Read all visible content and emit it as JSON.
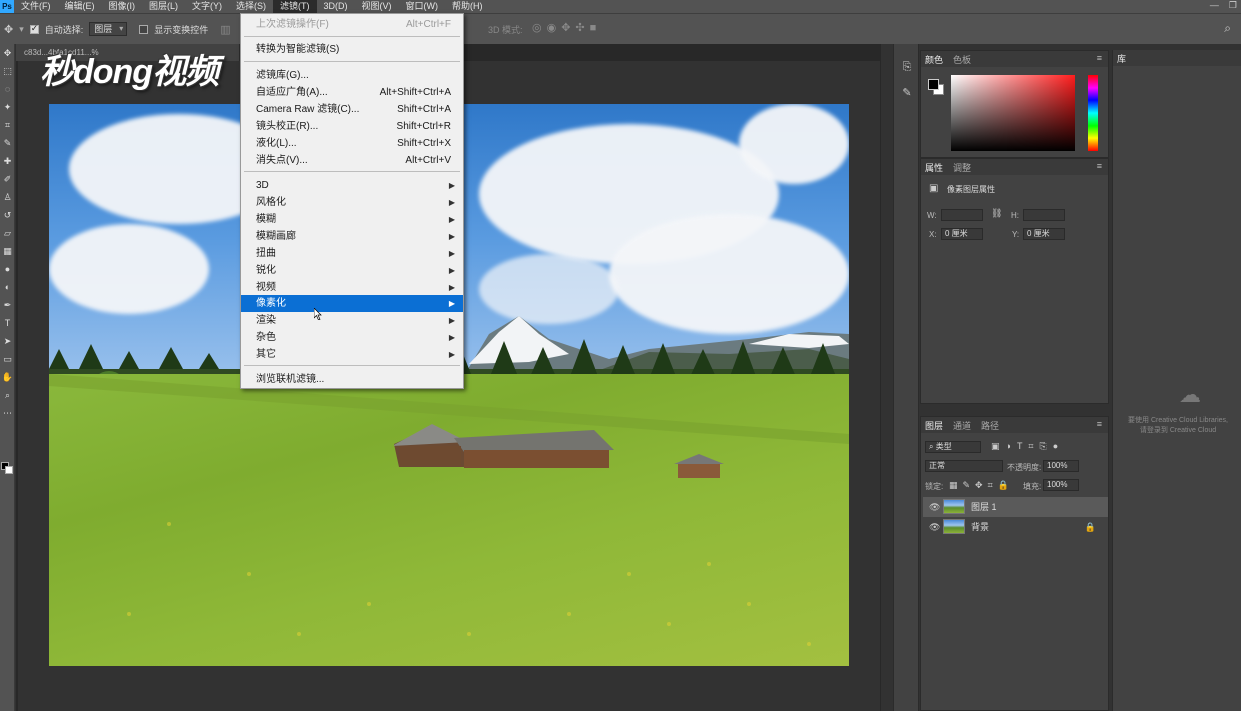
{
  "menubar": {
    "logo": "Ps",
    "items": [
      "文件(F)",
      "编辑(E)",
      "图像(I)",
      "图层(L)",
      "文字(Y)",
      "选择(S)",
      "滤镜(T)",
      "3D(D)",
      "视图(V)",
      "窗口(W)",
      "帮助(H)"
    ],
    "active_index": 6
  },
  "options_bar": {
    "auto_select_label": "自动选择:",
    "auto_select_value": "图层",
    "show_transform_label": "显示变换控件",
    "mode_label": "3D 模式:"
  },
  "document": {
    "tab_label": "c83d...4bfa1cd11...%"
  },
  "watermark": "秒dong视频",
  "filter_menu": {
    "items": [
      {
        "label": "上次滤镜操作(F)",
        "shortcut": "Alt+Ctrl+F",
        "disabled": true
      },
      {
        "label": "转换为智能滤镜(S)",
        "shortcut": ""
      },
      {
        "label": "滤镜库(G)...",
        "shortcut": ""
      },
      {
        "label": "自适应广角(A)...",
        "shortcut": "Alt+Shift+Ctrl+A"
      },
      {
        "label": "Camera Raw 滤镜(C)...",
        "shortcut": "Shift+Ctrl+A"
      },
      {
        "label": "镜头校正(R)...",
        "shortcut": "Shift+Ctrl+R"
      },
      {
        "label": "液化(L)...",
        "shortcut": "Shift+Ctrl+X"
      },
      {
        "label": "消失点(V)...",
        "shortcut": "Alt+Ctrl+V"
      },
      {
        "label": "3D",
        "submenu": true
      },
      {
        "label": "风格化",
        "submenu": true
      },
      {
        "label": "模糊",
        "submenu": true
      },
      {
        "label": "模糊画廊",
        "submenu": true
      },
      {
        "label": "扭曲",
        "submenu": true
      },
      {
        "label": "锐化",
        "submenu": true
      },
      {
        "label": "视频",
        "submenu": true
      },
      {
        "label": "像素化",
        "submenu": true,
        "highlighted": true
      },
      {
        "label": "渲染",
        "submenu": true
      },
      {
        "label": "杂色",
        "submenu": true
      },
      {
        "label": "其它",
        "submenu": true
      },
      {
        "label": "浏览联机滤镜...",
        "shortcut": ""
      }
    ]
  },
  "color_panel": {
    "tabs": [
      "颜色",
      "色板"
    ],
    "field_color": "#ff1d1d"
  },
  "properties_panel": {
    "tabs": [
      "属性",
      "调整"
    ],
    "title": "像素图层属性",
    "w_label": "W:",
    "h_label": "H:",
    "x_label": "X:",
    "x_value": "0 厘米",
    "y_label": "Y:",
    "y_value": "0 厘米"
  },
  "layers_panel": {
    "tabs": [
      "图层",
      "通道",
      "路径"
    ],
    "filter_label": "类型",
    "blend_mode": "正常",
    "opacity_label": "不透明度:",
    "opacity_value": "100%",
    "lock_label": "锁定:",
    "fill_label": "填充:",
    "fill_value": "100%",
    "layers": [
      {
        "name": "图层 1",
        "selected": true,
        "locked": false
      },
      {
        "name": "背景",
        "selected": false,
        "locked": true
      }
    ]
  },
  "library_panel": {
    "tab": "库",
    "note_line1": "要使用 Creative Cloud Libraries,",
    "note_line2": "请登录到 Creative Cloud"
  }
}
